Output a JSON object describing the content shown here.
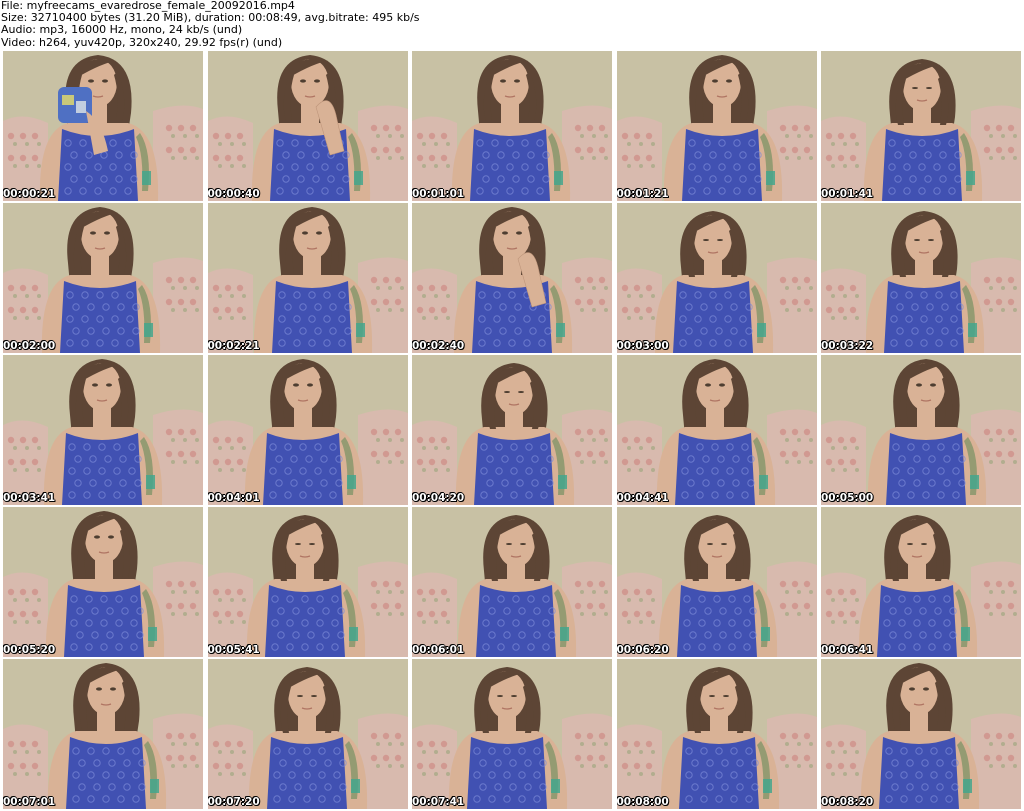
{
  "header": {
    "file_line": "File: myfreecams_evaredrose_female_20092016.mp4",
    "size_line": "Size: 32710400 bytes (31.20 MiB), duration: 00:08:49, avg.bitrate: 495 kb/s",
    "audio_line": "Audio: mp3, 16000 Hz, mono, 24 kb/s (und)",
    "video_line": "Video: h264, yuv420p, 320x240, 29.92 fps(r) (und)"
  },
  "thumbnails": [
    {
      "timestamp": "00:00:21",
      "pose": "mug"
    },
    {
      "timestamp": "00:00:40",
      "pose": "hand"
    },
    {
      "timestamp": "00:01:01",
      "pose": "center"
    },
    {
      "timestamp": "00:01:21",
      "pose": "center"
    },
    {
      "timestamp": "00:01:41",
      "pose": "down"
    },
    {
      "timestamp": "00:02:00",
      "pose": "center"
    },
    {
      "timestamp": "00:02:21",
      "pose": "center"
    },
    {
      "timestamp": "00:02:40",
      "pose": "hand"
    },
    {
      "timestamp": "00:03:00",
      "pose": "down"
    },
    {
      "timestamp": "00:03:22",
      "pose": "down"
    },
    {
      "timestamp": "00:03:41",
      "pose": "center"
    },
    {
      "timestamp": "00:04:01",
      "pose": "center"
    },
    {
      "timestamp": "00:04:20",
      "pose": "down"
    },
    {
      "timestamp": "00:04:41",
      "pose": "center"
    },
    {
      "timestamp": "00:05:00",
      "pose": "center"
    },
    {
      "timestamp": "00:05:20",
      "pose": "center"
    },
    {
      "timestamp": "00:05:41",
      "pose": "down"
    },
    {
      "timestamp": "00:06:01",
      "pose": "down"
    },
    {
      "timestamp": "00:06:20",
      "pose": "down"
    },
    {
      "timestamp": "00:06:41",
      "pose": "down"
    },
    {
      "timestamp": "00:07:01",
      "pose": "center"
    },
    {
      "timestamp": "00:07:20",
      "pose": "down"
    },
    {
      "timestamp": "00:07:41",
      "pose": "down"
    },
    {
      "timestamp": "00:08:00",
      "pose": "down"
    },
    {
      "timestamp": "00:08:20",
      "pose": "center"
    }
  ],
  "colors": {
    "wall": "#c8c3a8",
    "couch": "#d6b7b0",
    "dress": "#2b3fb4",
    "hair": "#4a3226",
    "skin": "#d8ae94",
    "timestamp_text": "#ffffff",
    "background": "#ffffff"
  }
}
